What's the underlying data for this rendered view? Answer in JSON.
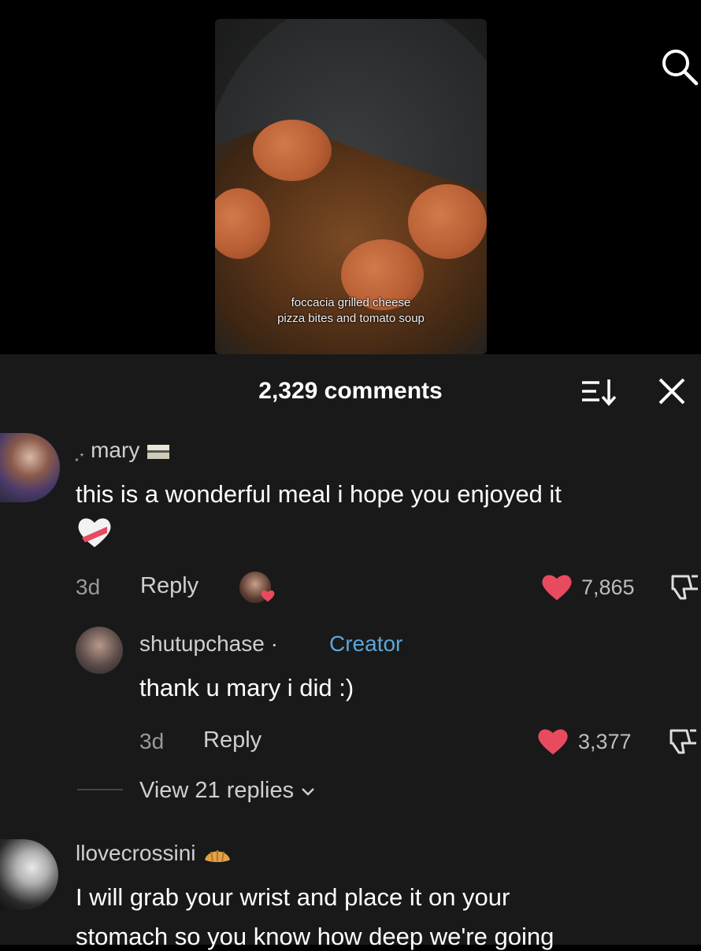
{
  "video": {
    "caption_line1": "foccacia grilled cheese",
    "caption_line2": "pizza bites and tomato soup"
  },
  "comments_header": {
    "count_label": "2,329 comments"
  },
  "comments": [
    {
      "username": "mary",
      "username_prefix": "⸼˖",
      "text": "this is a wonderful meal i hope you enjoyed it",
      "age": "3d",
      "reply_label": "Reply",
      "likes": "7,865"
    },
    {
      "username": "shutupchase",
      "separator": "·",
      "badge": "Creator",
      "text": "thank u mary i did :)",
      "age": "3d",
      "reply_label": "Reply",
      "likes": "3,377",
      "view_replies": "View 21 replies"
    },
    {
      "username": "llovecrossini",
      "text_line1": "I will grab your wrist and place it on your",
      "text_line2": "stomach so you know how deep we're going"
    }
  ],
  "colors": {
    "background": "#191919",
    "creator_badge": "#5ba6d6",
    "heart": "#e84a5f"
  }
}
